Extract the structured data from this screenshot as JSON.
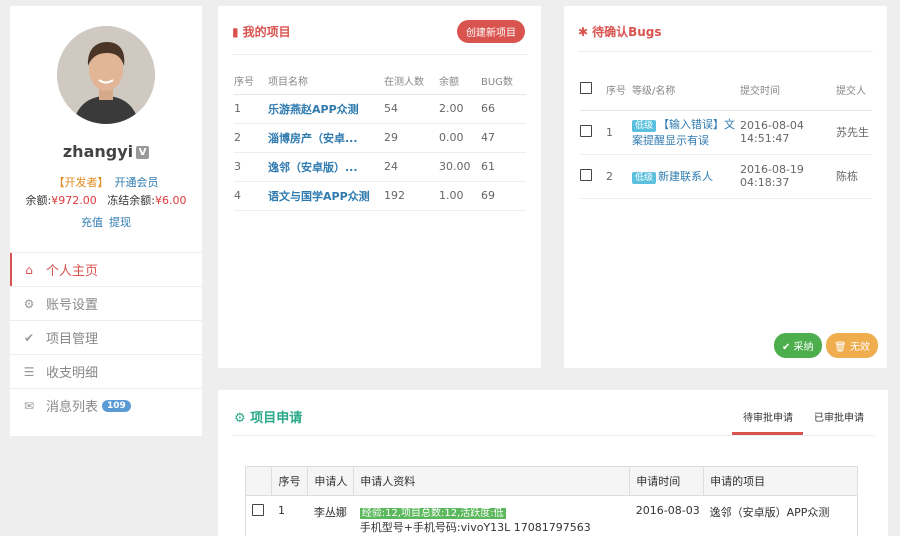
{
  "profile": {
    "username": "zhangyi",
    "verified_badge": "V",
    "role": "【开发者】",
    "membership_link": "开通会员",
    "balance_label": "余额:",
    "balance_value": "¥972.00",
    "frozen_label": "冻结余额:",
    "frozen_value": "¥6.00",
    "recharge_link": "充值",
    "withdraw_link": "提现"
  },
  "menu": {
    "items": [
      {
        "label": "个人主页",
        "icon": "home-icon",
        "active": true
      },
      {
        "label": "账号设置",
        "icon": "gear-icon"
      },
      {
        "label": "项目管理",
        "icon": "check-circle-icon"
      },
      {
        "label": "收支明细",
        "icon": "list-icon"
      },
      {
        "label": "消息列表",
        "icon": "mail-icon",
        "badge": "109"
      }
    ]
  },
  "projects": {
    "title": "我的项目",
    "create_button": "创建新项目",
    "columns": [
      "序号",
      "项目名称",
      "在测人数",
      "余额",
      "BUG数"
    ],
    "rows": [
      {
        "no": "1",
        "name": "乐游燕赵APP众测",
        "testers": "54",
        "balance": "2.00",
        "bugs": "66"
      },
      {
        "no": "2",
        "name": "淄博房产（安卓...",
        "testers": "29",
        "balance": "0.00",
        "bugs": "47"
      },
      {
        "no": "3",
        "name": "逸邻（安卓版）...",
        "testers": "24",
        "balance": "30.00",
        "bugs": "61"
      },
      {
        "no": "4",
        "name": "语文与国学APP众测",
        "testers": "192",
        "balance": "1.00",
        "bugs": "69"
      }
    ]
  },
  "bugs": {
    "title": "待确认Bugs",
    "columns": {
      "no": "序号",
      "level_name": "等级/名称",
      "time": "提交时间",
      "submitter": "提交人"
    },
    "rows": [
      {
        "no": "1",
        "level": "低级",
        "name": "【输入错误】文案提醒显示有误",
        "time": "2016-08-04 14:51:47",
        "submitter": "苏先生"
      },
      {
        "no": "2",
        "level": "低级",
        "name": "新建联系人",
        "time": "2016-08-19 04:18:37",
        "submitter": "陈栋"
      }
    ],
    "accept_button": "✔ 采纳",
    "invalid_button": "无效"
  },
  "applications": {
    "title": "项目申请",
    "tabs": [
      "待审批申请",
      "已审批申请"
    ],
    "columns": [
      "序号",
      "申请人",
      "申请人资料",
      "申请时间",
      "申请的项目"
    ],
    "rows": [
      {
        "no": "1",
        "applicant": "李丛娜",
        "profile_highlight": "经验:12,项目总数:12,活跃度:低",
        "profile_device": "手机型号+手机号码:vivoY13L 17081797563",
        "time": "2016-08-03",
        "project": "逸邻（安卓版）APP众测"
      }
    ]
  },
  "colors": {
    "accent_red": "#d9534f",
    "link_blue": "#2f7bb0",
    "teal": "#2ba98a",
    "green": "#4cae4c",
    "orange": "#f0ad4e"
  }
}
